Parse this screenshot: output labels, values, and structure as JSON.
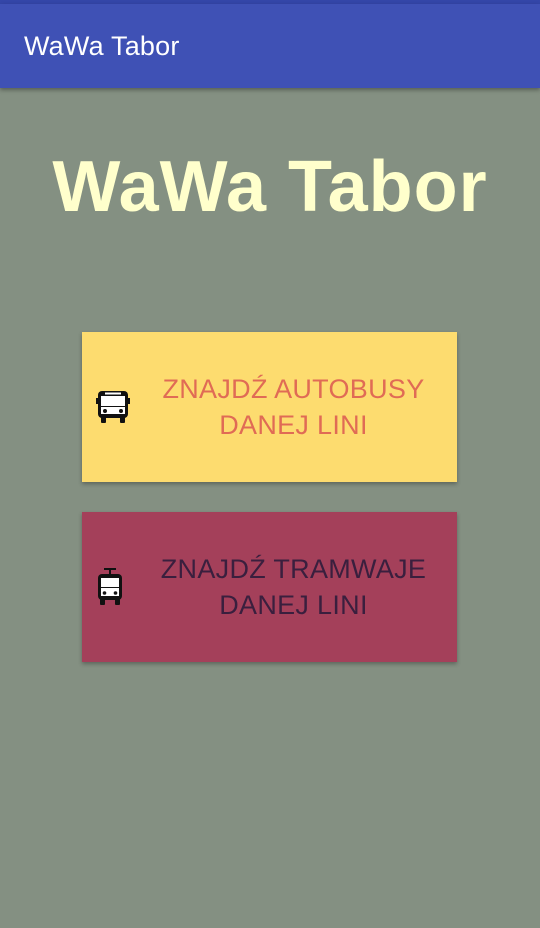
{
  "app_bar": {
    "title": "WaWa Tabor"
  },
  "main": {
    "hero_title": "WaWa Tabor",
    "buttons": [
      {
        "label": "ZNAJDŹ AUTOBUSY DANEJ LINI",
        "icon": "bus-icon",
        "background": "#fddc6f",
        "text_color": "#e06b55"
      },
      {
        "label": "ZNAJDŹ TRAMWAJE DANEJ LINI",
        "icon": "tram-icon",
        "background": "#a4405a",
        "text_color": "#3a1f3e"
      }
    ]
  },
  "colors": {
    "app_bar": "#3f51b5",
    "status_bar": "#3446a8",
    "background": "#849082",
    "hero_title": "#ffffcc"
  }
}
